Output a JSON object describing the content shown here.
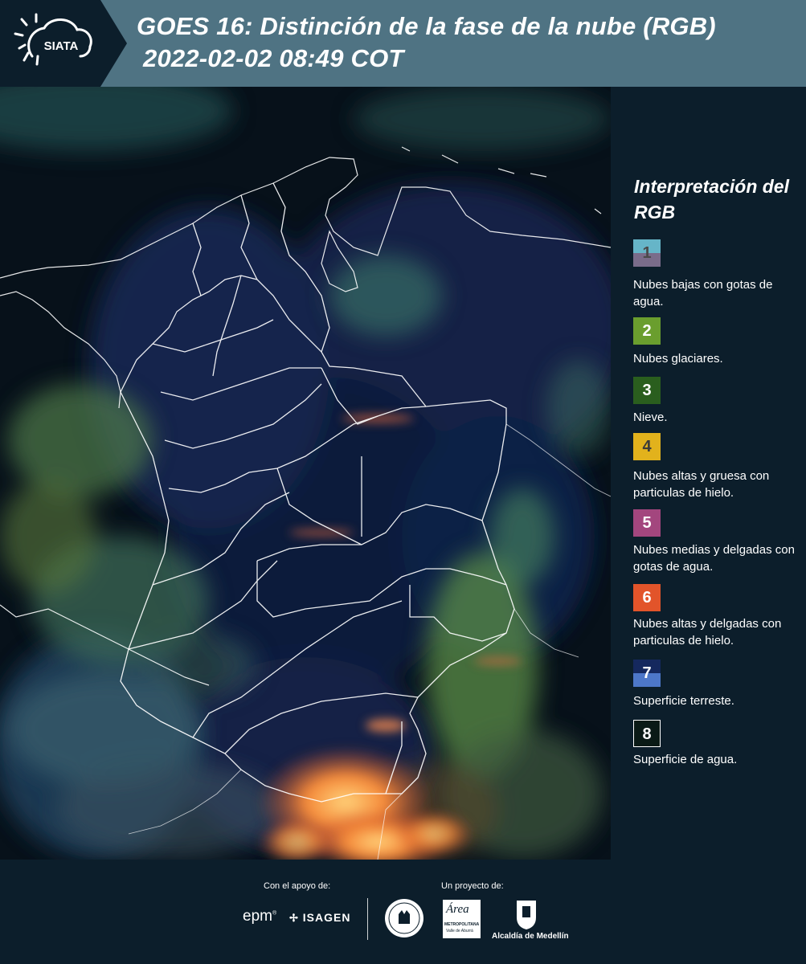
{
  "header": {
    "logo_text": "SIATA",
    "title_line1": "GOES 16: Distinción de la fase de la nube (RGB)",
    "title_line2": "2022-02-02 08:49 COT",
    "bg_color": "#4f7383",
    "logo_bg_color": "#0c1e2b"
  },
  "legend": {
    "title": "Interpretación del RGB",
    "items": [
      {
        "number": "1",
        "description": "Nubes bajas con gotas de agua.",
        "colors": [
          "#66b5c8",
          "#7a6c8a"
        ]
      },
      {
        "number": "2",
        "description": "Nubes glaciares.",
        "colors": [
          "#6a9e2e"
        ]
      },
      {
        "number": "3",
        "description": "Nieve.",
        "colors": [
          "#2a5e1e"
        ]
      },
      {
        "number": "4",
        "description": "Nubes altas y gruesa con particulas de hielo.",
        "colors": [
          "#e2b21c"
        ]
      },
      {
        "number": "5",
        "description": "Nubes medias y delgadas con gotas de agua.",
        "colors": [
          "#a3467e"
        ]
      },
      {
        "number": "6",
        "description": "Nubes altas y delgadas con particulas de hielo.",
        "colors": [
          "#e2542a"
        ]
      },
      {
        "number": "7",
        "description": "Superficie terreste.",
        "colors": [
          "#15285e",
          "#4d77c9"
        ]
      },
      {
        "number": "8",
        "description": "Superficie de agua.",
        "colors": [
          "#0a1a16"
        ]
      }
    ]
  },
  "footer": {
    "support_label": "Con el apoyo de:",
    "project_label": "Un proyecto de:",
    "sponsors": [
      "epm",
      "ISAGEN"
    ],
    "area_metropolitana": "Área",
    "area_sub": "METROPOLITANA",
    "area_sub2": "Valle de Aburrá",
    "alcaldia": "Alcaldía de Medellín"
  }
}
